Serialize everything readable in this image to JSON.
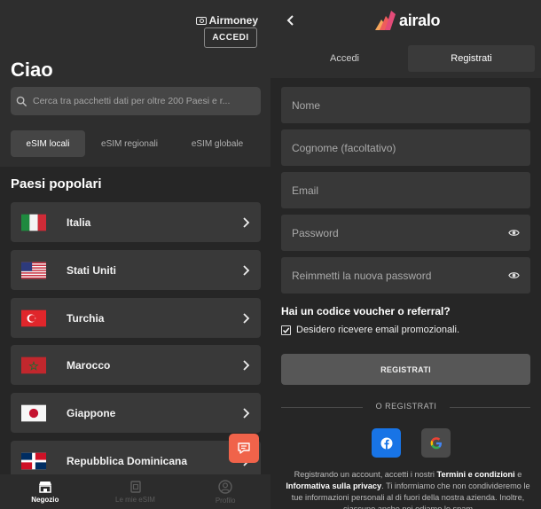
{
  "left": {
    "airmoney_label": "Airmoney",
    "accedi_label": "ACCEDI",
    "greeting": "Ciao",
    "search_placeholder": "Cerca tra pacchetti dati per oltre 200 Paesi e r...",
    "tabs": [
      "eSIM locali",
      "eSIM regionali",
      "eSIM globale"
    ],
    "section_title": "Paesi popolari",
    "countries": [
      {
        "name": "Italia",
        "flag": "italy-flag-icon"
      },
      {
        "name": "Stati Uniti",
        "flag": "usa-flag-icon"
      },
      {
        "name": "Turchia",
        "flag": "turkey-flag-icon"
      },
      {
        "name": "Marocco",
        "flag": "morocco-flag-icon"
      },
      {
        "name": "Giappone",
        "flag": "japan-flag-icon"
      },
      {
        "name": "Repubblica Dominicana",
        "flag": "dominican-republic-flag-icon"
      }
    ],
    "nav": [
      {
        "label": "Negozio",
        "icon": "store-icon",
        "active": true
      },
      {
        "label": "Le mie eSIM",
        "icon": "sim-icon",
        "active": false
      },
      {
        "label": "Profilo",
        "icon": "profile-icon",
        "active": false
      }
    ]
  },
  "right": {
    "logo_text": "airalo",
    "tabs": [
      "Accedi",
      "Registrati"
    ],
    "fields": {
      "nome": "Nome",
      "cognome": "Cognome (facoltativo)",
      "email": "Email",
      "password": "Password",
      "password_confirm": "Reimmetti la nuova password"
    },
    "voucher_label": "Hai un codice voucher o referral?",
    "promo_label": "Desidero ricevere email promozionali.",
    "register_button": "REGISTRATI",
    "or_label": "O REGISTRATI",
    "legal": {
      "part1": "Registrando un account, accetti i nostri ",
      "terms": "Termini e condizioni",
      "part2": " e ",
      "privacy": "Informativa sulla privacy",
      "part3": ". Ti informiamo che non condivideremo le tue informazioni personali al di fuori della nostra azienda. Inoltre, ciascuno anche noi odiamo lo spam"
    }
  },
  "colors": {
    "accent_orange": "#f0634a",
    "facebook_blue": "#1874e6"
  }
}
